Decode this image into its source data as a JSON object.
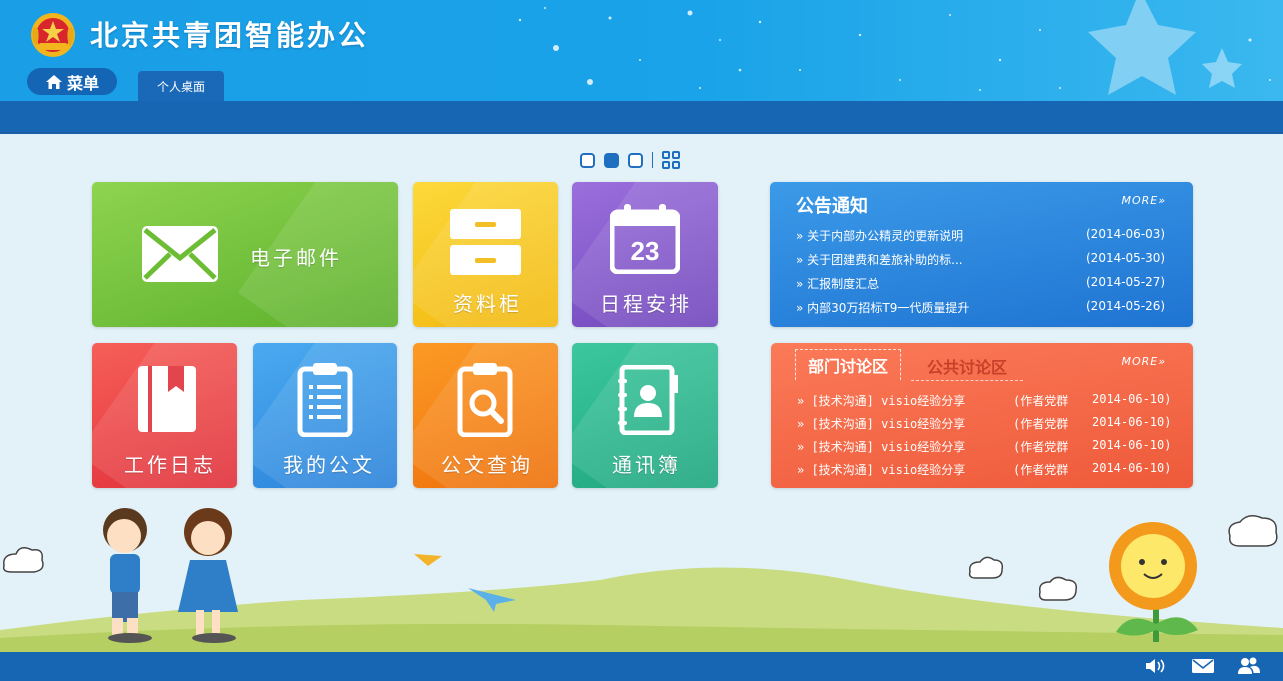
{
  "header": {
    "title": "北京共青团智能办公",
    "logo_icon": "youth-league-emblem"
  },
  "menu": {
    "label": "菜单",
    "icon": "home-icon"
  },
  "tabs": [
    {
      "label": "个人桌面"
    }
  ],
  "pager": {
    "pages": 3,
    "active": 2
  },
  "tiles": [
    {
      "label": "电子邮件",
      "icon": "envelope-icon",
      "color": "#6cc03c"
    },
    {
      "label": "资料柜",
      "icon": "cabinet-icon",
      "color": "#f5c21b"
    },
    {
      "label": "日程安排",
      "icon": "calendar-icon",
      "calendar_day": "23",
      "color": "#7f58c7"
    },
    {
      "label": "工作日志",
      "icon": "journal-icon",
      "color": "#ee3d40"
    },
    {
      "label": "我的公文",
      "icon": "clipboard-icon",
      "color": "#2f8fe4"
    },
    {
      "label": "公文查询",
      "icon": "document-search-icon",
      "color": "#f27a0e"
    },
    {
      "label": "通讯簿",
      "icon": "contacts-book-icon",
      "color": "#22ae86"
    }
  ],
  "notices": {
    "title": "公告通知",
    "more": "MORE»",
    "items": [
      {
        "text": "关于内部办公精灵的更新说明",
        "date": "(2014-06-03)"
      },
      {
        "text": "关于团建费和差旅补助的标...",
        "date": "(2014-05-30)"
      },
      {
        "text": "汇报制度汇总",
        "date": "(2014-05-27)"
      },
      {
        "text": "内部30万招标T9一代质量提升",
        "date": "(2014-05-26)"
      }
    ]
  },
  "discussion": {
    "tab_active": "部门讨论区",
    "tab_inactive": "公共讨论区",
    "more": "MORE»",
    "items": [
      {
        "tag": "[技术沟通]",
        "title": "visio经验分享",
        "author": "(作者党群",
        "date": "2014-06-10)"
      },
      {
        "tag": "[技术沟通]",
        "title": "visio经验分享",
        "author": "(作者党群",
        "date": "2014-06-10)"
      },
      {
        "tag": "[技术沟通]",
        "title": "visio经验分享",
        "author": "(作者党群",
        "date": "2014-06-10)"
      },
      {
        "tag": "[技术沟通]",
        "title": "visio经验分享",
        "author": "(作者党群",
        "date": "2014-06-10)"
      }
    ]
  },
  "footer": {
    "icons": [
      "speaker-icon",
      "mail-icon",
      "users-icon"
    ]
  }
}
